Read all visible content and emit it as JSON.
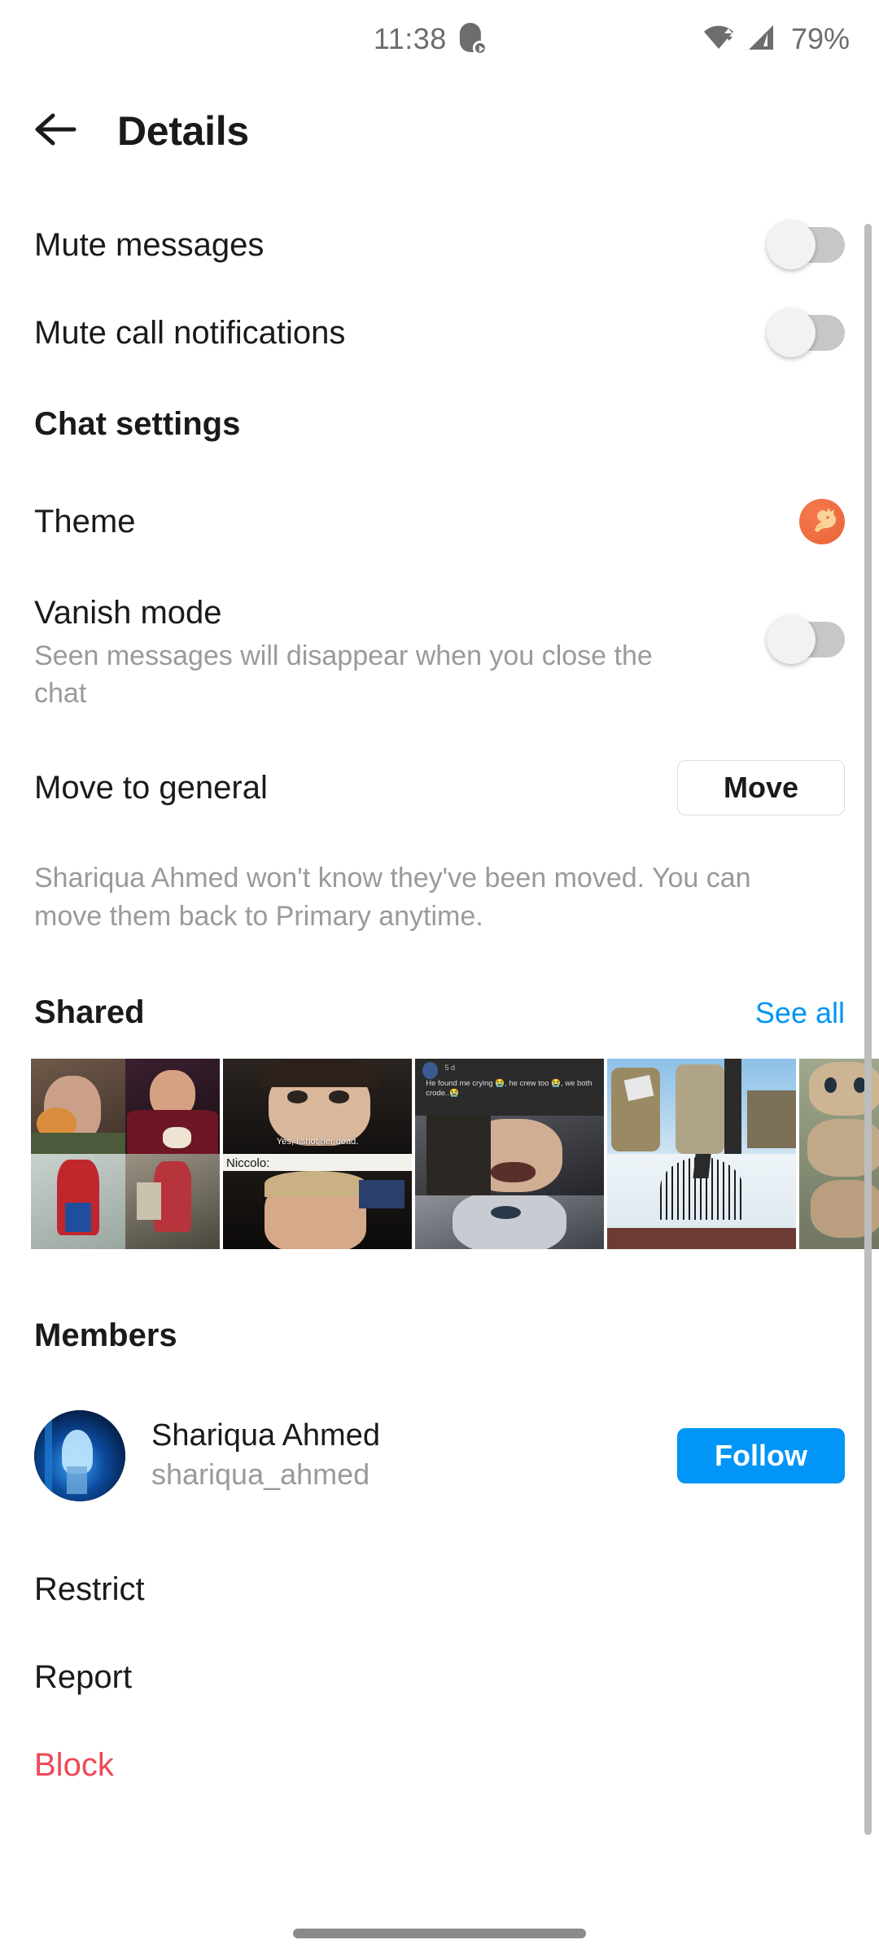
{
  "status_bar": {
    "time": "11:38",
    "app_icon": "media-notification-icon",
    "wifi_icon": "wifi-icon",
    "signal_icon": "cellular-signal-icon",
    "battery": "79%"
  },
  "header": {
    "back_icon": "back-arrow-icon",
    "title": "Details"
  },
  "settings": {
    "mute_messages": {
      "label": "Mute messages",
      "toggle_state": "off"
    },
    "mute_call_notifications": {
      "label": "Mute call notifications",
      "toggle_state": "off"
    },
    "chat_settings_title": "Chat settings",
    "theme": {
      "label": "Theme",
      "swatch_icon": "dragon-theme-icon",
      "swatch_color": "#ed6a3f"
    },
    "vanish_mode": {
      "label": "Vanish mode",
      "description": "Seen messages will disappear when you close the chat",
      "toggle_state": "off"
    },
    "move_to_general": {
      "label": "Move to general",
      "button_label": "Move",
      "note": "Shariqua Ahmed won't know they've been moved. You can move them back to Primary anytime."
    }
  },
  "shared": {
    "title": "Shared",
    "see_all_label": "See all",
    "thumbnails": [
      {
        "name": "spider-man-burger-meme",
        "caption": ""
      },
      {
        "name": "niccolo-shot-her-dead-meme",
        "caption_top": "Yes, I shot her dead.",
        "caption_bottom": "Niccolo:"
      },
      {
        "name": "he-found-me-crying-meme",
        "caption": "He found me crying 😭, he crew too 😭, we both crode..😭",
        "meta": "5 d"
      },
      {
        "name": "attack-on-titan-scene",
        "caption": ""
      },
      {
        "name": "attack-on-titan-faces",
        "caption": ""
      }
    ]
  },
  "members": {
    "title": "Members",
    "list": [
      {
        "avatar_name": "shariqua-avatar",
        "display_name": "Shariqua Ahmed",
        "username": "shariqua_ahmed",
        "action_label": "Follow"
      }
    ]
  },
  "actions": [
    {
      "name": "restrict",
      "label": "Restrict",
      "danger": false
    },
    {
      "name": "report",
      "label": "Report",
      "danger": false
    },
    {
      "name": "block",
      "label": "Block",
      "danger": true
    }
  ],
  "colors": {
    "accent_blue": "#0095f6",
    "danger_red": "#ed4956",
    "text_primary": "#1a1a1a",
    "text_secondary": "#9a9a9a",
    "toggle_track_off": "#c7c7c7"
  },
  "system": {
    "scrollbar": "vertical-scrollbar",
    "home_indicator": "home-indicator"
  }
}
